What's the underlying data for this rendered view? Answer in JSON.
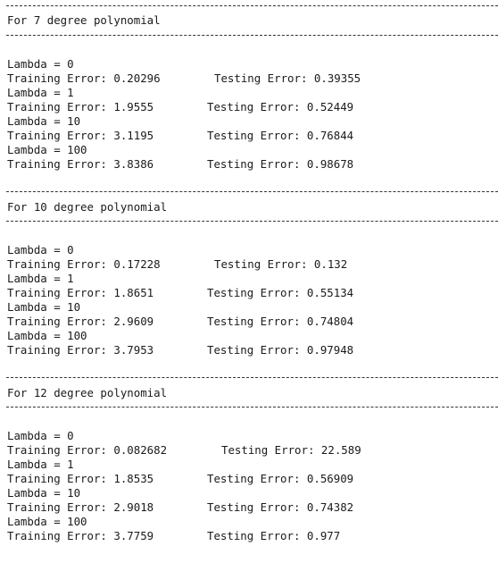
{
  "console": {
    "blocks": [
      {
        "title": "For 7 degree polynomial",
        "rows": [
          {
            "lambda": "Lambda = 0",
            "training": "Training Error: 0.20296",
            "testing": "Testing Error: 0.39355"
          },
          {
            "lambda": "Lambda = 1",
            "training": "Training Error: 1.9555",
            "testing": "Testing Error: 0.52449"
          },
          {
            "lambda": "Lambda = 10",
            "training": "Training Error: 3.1195",
            "testing": "Testing Error: 0.76844"
          },
          {
            "lambda": "Lambda = 100",
            "training": "Training Error: 3.8386",
            "testing": "Testing Error: 0.98678"
          }
        ]
      },
      {
        "title": "For 10 degree polynomial",
        "rows": [
          {
            "lambda": "Lambda = 0",
            "training": "Training Error: 0.17228",
            "testing": "Testing Error: 0.132"
          },
          {
            "lambda": "Lambda = 1",
            "training": "Training Error: 1.8651",
            "testing": "Testing Error: 0.55134"
          },
          {
            "lambda": "Lambda = 10",
            "training": "Training Error: 2.9609",
            "testing": "Testing Error: 0.74804"
          },
          {
            "lambda": "Lambda = 100",
            "training": "Training Error: 3.7953",
            "testing": "Testing Error: 0.97948"
          }
        ]
      },
      {
        "title": "For 12 degree polynomial",
        "rows": [
          {
            "lambda": "Lambda = 0",
            "training": "Training Error: 0.082682",
            "testing": "Testing Error: 22.589"
          },
          {
            "lambda": "Lambda = 1",
            "training": "Training Error: 1.8535",
            "testing": "Testing Error: 0.56909"
          },
          {
            "lambda": "Lambda = 10",
            "training": "Training Error: 2.9018",
            "testing": "Testing Error: 0.74382"
          },
          {
            "lambda": "Lambda = 100",
            "training": "Training Error: 3.7759",
            "testing": "Testing Error: 0.977"
          }
        ]
      }
    ]
  }
}
